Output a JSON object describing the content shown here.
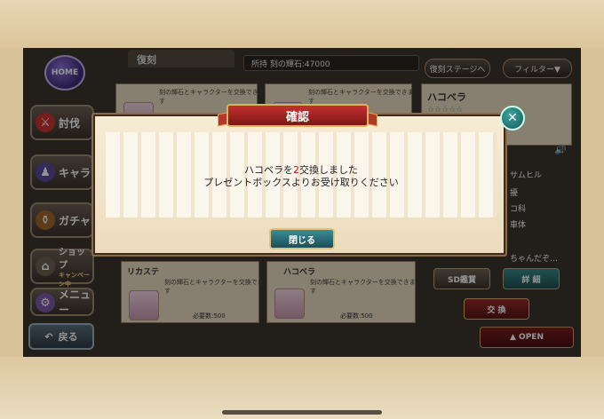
{
  "sidebar": {
    "home": "HOME",
    "items": [
      {
        "label": "討伐",
        "icon": "sword-icon"
      },
      {
        "label": "キャラ",
        "icon": "character-icon"
      },
      {
        "label": "ガチャ",
        "icon": "pot-icon"
      },
      {
        "label": "ショップ",
        "sub": "キャンペーン中",
        "icon": "shop-icon"
      },
      {
        "label": "メニュー",
        "icon": "gear-icon"
      }
    ],
    "back": "戻る"
  },
  "header": {
    "section_title": "復刻",
    "currency_label": "所持 刻の輝石:47000",
    "stage_button": "復刻ステージへ",
    "filter_button": "フィルター▼"
  },
  "cards": {
    "top_left_desc": "刻の輝石とキャラクターを交換できます",
    "top_mid_desc": "刻の輝石とキャラクターを交換できます",
    "top_right_name": "ハコベラ",
    "bottom_left_name": "リカステ",
    "bottom_left_desc": "刻の輝石とキャラクターを交換できます",
    "bottom_left_req": "必要数:500",
    "bottom_mid_name": "ハコベラ",
    "bottom_mid_desc": "刻の輝石とキャラクターを交換できます",
    "bottom_mid_req": "必要数:500"
  },
  "detail": {
    "name_partial": "サムヒル",
    "line1": "擾",
    "line2": "コ科",
    "line3": "車体",
    "quote": "ちゃんだぞ…",
    "sd_button": "SD鑑賞",
    "detail_button": "詳 細",
    "exchange_button": "交 換",
    "open_button": "▲ OPEN"
  },
  "modal": {
    "title": "確認",
    "message_prefix": "ハコベラを",
    "message_count": "2",
    "message_suffix": "交換しました",
    "message_line2": "プレゼントボックスよりお受け取りください",
    "close_button": "閉じる"
  },
  "colors": {
    "ribbon": "#c43030",
    "close_button": "#3c8c98",
    "count_highlight": "#cc1111"
  }
}
